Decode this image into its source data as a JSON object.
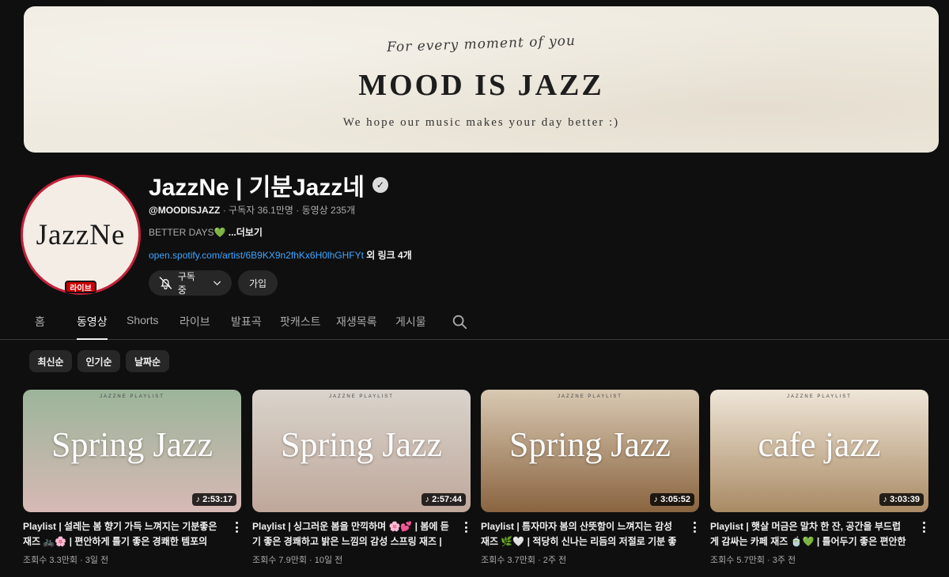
{
  "banner": {
    "script_line": "For every moment of you",
    "title": "MOOD IS JAZZ",
    "subtitle": "We hope our music makes your day better :)"
  },
  "channel": {
    "avatar_text": "JazzNe",
    "live_badge": "라이브",
    "name": "JazzNe | 기분Jazz네",
    "handle": "@MOODISJAZZ",
    "stats": " · 구독자 36.1만명 · 동영상 235개",
    "description": "BETTER DAYS💚",
    "more": " ...더보기",
    "link_url": "open.spotify.com/artist/6B9KX9n2fhKx6H0lhGHFYt",
    "link_extra": " 외 링크 4개",
    "subscribed_label": "구독중",
    "join_label": "가입"
  },
  "tabs": [
    "홈",
    "동영상",
    "Shorts",
    "라이브",
    "발표곡",
    "팟캐스트",
    "재생목록",
    "게시물"
  ],
  "active_tab": "동영상",
  "chips": [
    "최신순",
    "인기순",
    "날짜순"
  ],
  "videos": [
    {
      "thumb_text": "Spring Jazz",
      "thumb_label": "JAZZNE PLAYLIST",
      "duration": "2:53:17",
      "title": "Playlist | 설레는 봄 향기 가득 느껴지는 기분좋은 재즈 🚲🌸 | 편안하게 틀기 좋은 경쾌한 템포의 기...",
      "meta": "조회수 3.3만회 · 3일 전",
      "colors": [
        "#9bb59a",
        "#d7b9b4"
      ]
    },
    {
      "thumb_text": "Spring Jazz",
      "thumb_label": "JAZZNE PLAYLIST",
      "duration": "2:57:44",
      "title": "Playlist | 싱그러운 봄을 만끽하며 🌸💕 | 봄에 듣기 좋은 경쾌하고 밝은 느낌의 감성 스프링 재즈 | 매...",
      "meta": "조회수 7.9만회 · 10일 전",
      "colors": [
        "#d9d4cc",
        "#bfa79a"
      ]
    },
    {
      "thumb_text": "Spring Jazz",
      "thumb_label": "JAZZNE PLAYLIST",
      "duration": "3:05:52",
      "title": "Playlist | 틈자마자 봄의 산뜻함이 느껴지는 감성 재즈 🌿🤍 | 적당히 신나는 리듬의 저절로 기분 좋아...",
      "meta": "조회수 3.7만회 · 2주 전",
      "colors": [
        "#d8c9b2",
        "#8a6440"
      ]
    },
    {
      "thumb_text": "cafe jazz",
      "thumb_label": "JAZZNE PLAYLIST",
      "duration": "3:03:39",
      "title": "Playlist | 햇살 머금은 말차 한 잔, 공간을 부드럽게 감싸는 카페 재즈 🍵💚 | 틀어두기 좋은 편안한 템...",
      "meta": "조회수 5.7만회 · 3주 전",
      "colors": [
        "#efe6d8",
        "#a98a64"
      ]
    }
  ]
}
